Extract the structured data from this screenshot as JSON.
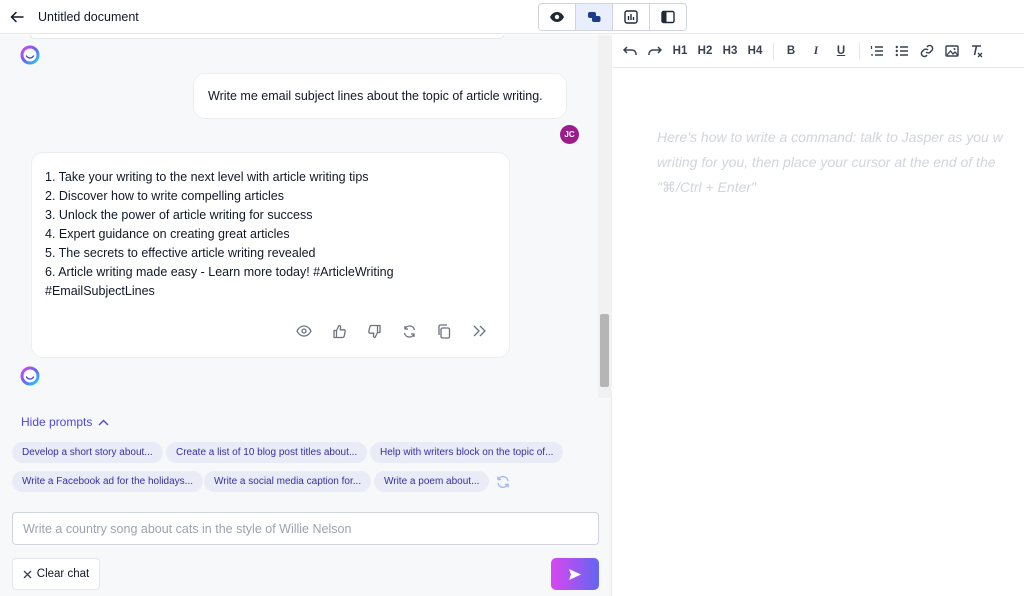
{
  "header": {
    "title": "Untitled document",
    "view_modes": [
      "preview-icon",
      "chat-icon",
      "editor-icon",
      "sidebar-layout-icon"
    ],
    "active_view": 1
  },
  "chat": {
    "user_message": "Write me email subject lines about the topic of article writing.",
    "user_initials": "JC",
    "ai_response_lines": [
      "1. Take your writing to the next level with article writing tips",
      "2. Discover how to write compelling articles",
      "3. Unlock the power of article writing for success",
      "4. Expert guidance on creating great articles",
      "5. The secrets to effective article writing revealed",
      "6. Article writing made easy - Learn more today! #ArticleWriting",
      "#EmailSubjectLines"
    ],
    "ai_actions": [
      "eye-icon",
      "thumbs-up-icon",
      "thumbs-down-icon",
      "regenerate-icon",
      "copy-icon",
      "insert-chevrons-icon"
    ],
    "hide_prompts_label": "Hide prompts",
    "prompts": [
      "Develop a short story about...",
      "Create a list of 10 blog post titles about...",
      "Help with writers block on the topic of...",
      "Write a Facebook ad for the holidays...",
      "Write a social media caption for...",
      "Write a poem about..."
    ],
    "input_placeholder": "Write a country song about cats in the style of Willie Nelson",
    "clear_label": "Clear chat"
  },
  "editor": {
    "toolbar": [
      "undo",
      "redo",
      "H1",
      "H2",
      "H3",
      "H4",
      "B",
      "I",
      "U",
      "ordered-list",
      "bullet-list",
      "link",
      "image",
      "clear-format"
    ],
    "placeholder_lines": [
      "Here's how to write a command: talk to Jasper as you w",
      "writing for you, then place your cursor at the end of the",
      "\"⌘/Ctrl + Enter\""
    ]
  },
  "colors": {
    "accent": "#4f46e5",
    "chip_bg": "#e9ebf7",
    "user_avatar": "#9b1c8c",
    "send_gradient_start": "#d946ef",
    "send_gradient_end": "#6366f1"
  }
}
